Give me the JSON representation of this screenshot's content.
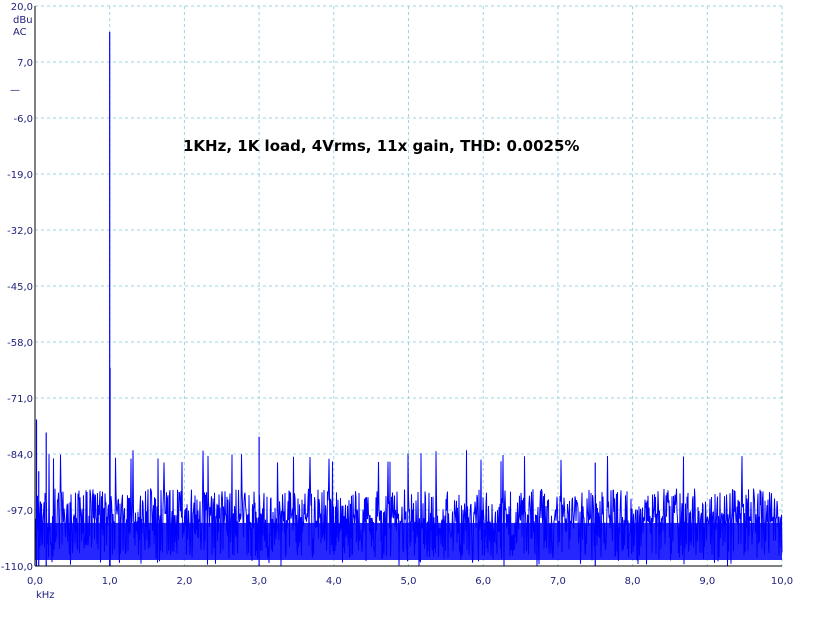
{
  "chart_data": {
    "type": "line",
    "annotation": "1KHz, 1K load, 4Vrms, 11x gain, THD: 0.0025%",
    "y_unit_lines": [
      "dBu",
      "AC"
    ],
    "legend_marker": "—",
    "xlabel": "kHz",
    "ylabel": "",
    "xlim": [
      0,
      10
    ],
    "ylim": [
      -110,
      20
    ],
    "x_ticks": [
      0,
      1,
      2,
      3,
      4,
      5,
      6,
      7,
      8,
      9,
      10
    ],
    "x_tick_labels": [
      "0,0",
      "1,0",
      "2,0",
      "3,0",
      "4,0",
      "5,0",
      "6,0",
      "7,0",
      "8,0",
      "9,0",
      "10,0"
    ],
    "y_ticks": [
      20,
      7,
      -6,
      -19,
      -32,
      -45,
      -58,
      -71,
      -84,
      -97,
      -110
    ],
    "y_tick_labels": [
      "20,0",
      "7,0",
      "-6,0",
      "-19,0",
      "-32,0",
      "-45,0",
      "-58,0",
      "-71,0",
      "-84,0",
      "-97,0",
      "-110,0"
    ],
    "grid": true,
    "grid_style": "dashed",
    "colors": {
      "series": "#0000ff",
      "grid": "#9fd3e3",
      "axis": "#000000",
      "tick_text": "#1f1f7a"
    },
    "noise_floor_band": [
      -110,
      -88
    ],
    "series": [
      {
        "x": [
          0.02,
          0.05,
          0.15,
          1.0,
          1.005,
          3.0,
          7.5
        ],
        "y": [
          -76,
          -88,
          -79,
          14,
          -64,
          -80,
          -86
        ]
      }
    ]
  }
}
